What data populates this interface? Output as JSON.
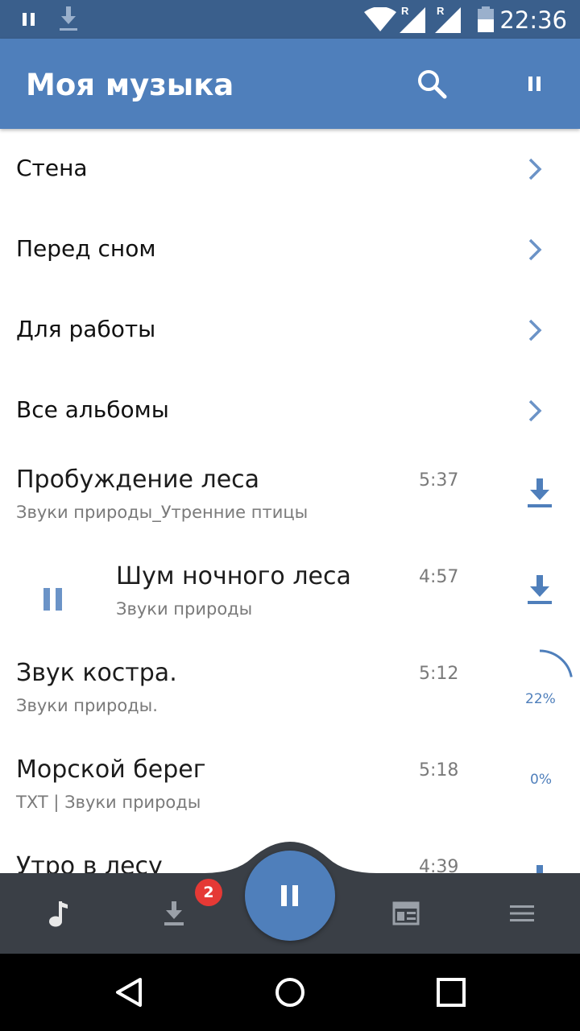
{
  "status_bar": {
    "time": "22:36",
    "signal_label_1": "R",
    "signal_label_2": "R",
    "icons": [
      "pause-icon",
      "download-icon",
      "wifi-icon",
      "signal-icon",
      "signal-icon",
      "battery-icon"
    ]
  },
  "app_bar": {
    "title": "Моя музыка",
    "icons": [
      "search-icon",
      "pause-icon"
    ]
  },
  "nav_items": [
    {
      "label": "Стена",
      "icon": "chevron-right-icon"
    },
    {
      "label": "Перед сном",
      "icon": "chevron-right-icon"
    },
    {
      "label": "Для работы",
      "icon": "chevron-right-icon"
    },
    {
      "label": "Все альбомы",
      "icon": "chevron-right-icon"
    }
  ],
  "tracks": [
    {
      "title": "Пробуждение леса",
      "subtitle": "Звуки природы_Утренние птицы",
      "duration": "5:37",
      "action": "download-icon"
    },
    {
      "title": "Шум ночного леса",
      "subtitle": "Звуки природы",
      "duration": "4:57",
      "action": "download-icon",
      "state": "playing",
      "play_icon": "pause-icon"
    },
    {
      "title": "Звук костра.",
      "subtitle": "Звуки природы.",
      "duration": "5:12",
      "action": "progress",
      "progress_label": "22%",
      "progress": 0.22
    },
    {
      "title": "Морской берег",
      "subtitle": "TXT | Звуки природы",
      "duration": "5:18",
      "action": "progress",
      "progress_label": "0%",
      "progress": 0
    },
    {
      "title": "Утро в лесу",
      "subtitle": "",
      "duration": "4:39",
      "action": "download-icon"
    }
  ],
  "tab_bar": {
    "tabs": [
      {
        "icon": "music-note-icon"
      },
      {
        "icon": "download-icon",
        "badge": "2"
      },
      {
        "icon": "pause-icon",
        "primary": true
      },
      {
        "icon": "news-feed-icon"
      },
      {
        "icon": "menu-icon"
      }
    ]
  },
  "system_nav": {
    "icons": [
      "back-icon",
      "home-icon",
      "recents-icon"
    ]
  },
  "colors": {
    "accent": "#4f7fbb",
    "status_bar": "#3a5f8c",
    "tab_bar": "#3a3f46",
    "badge": "#e53935"
  }
}
